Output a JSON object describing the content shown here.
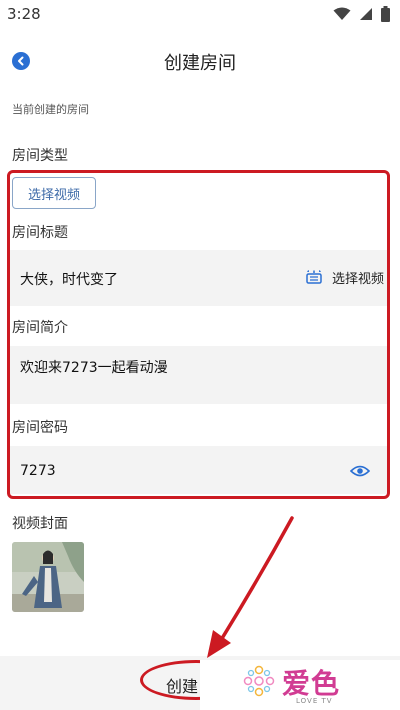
{
  "status_bar": {
    "time": "3:28"
  },
  "header": {
    "title": "创建房间"
  },
  "labels": {
    "current_room": "当前创建的房间",
    "room_type": "房间类型",
    "room_title": "房间标题",
    "room_intro": "房间简介",
    "room_password": "房间密码",
    "video_cover": "视频封面"
  },
  "buttons": {
    "select_video_primary": "选择视频",
    "select_video_link": "选择视频",
    "create": "创建"
  },
  "fields": {
    "title_value": "大侠，时代变了",
    "intro_value": "欢迎来7273一起看动漫",
    "password_value": "7273"
  },
  "watermark": {
    "text": "爱色",
    "sub": "LOVE TV"
  },
  "colors": {
    "accent": "#2a6fd3",
    "annotation_red": "#cc1a22",
    "field_bg": "#f3f3f3",
    "watermark_pink": "#d13c93"
  }
}
